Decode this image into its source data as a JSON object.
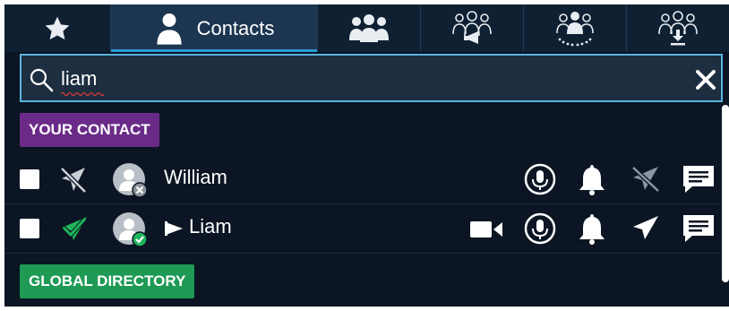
{
  "tabs": [
    {
      "icon": "star-icon",
      "label": ""
    },
    {
      "icon": "contact-person-icon",
      "label": "Contacts"
    },
    {
      "icon": "group-icon",
      "label": ""
    },
    {
      "icon": "broadcast-group-icon",
      "label": ""
    },
    {
      "icon": "conference-group-icon",
      "label": ""
    },
    {
      "icon": "download-group-icon",
      "label": ""
    }
  ],
  "search": {
    "value": "liam",
    "placeholder": ""
  },
  "sections": {
    "your_contact": "YOUR CONTACT",
    "global_directory": "GLOBAL DIRECTORY"
  },
  "contacts": [
    {
      "name": "William",
      "status": "offline",
      "flag": false,
      "actions": [
        "mic-icon",
        "bell-icon",
        "send-disabled-icon",
        "message-icon"
      ]
    },
    {
      "name": "Liam",
      "status": "online",
      "flag": true,
      "actions": [
        "video-icon",
        "mic-icon",
        "bell-icon",
        "send-icon",
        "message-icon"
      ]
    }
  ],
  "colors": {
    "accent": "#2d9bd8",
    "your_contact_badge": "#6a2b88",
    "global_badge": "#1e9a55",
    "online": "#1eb55a"
  }
}
